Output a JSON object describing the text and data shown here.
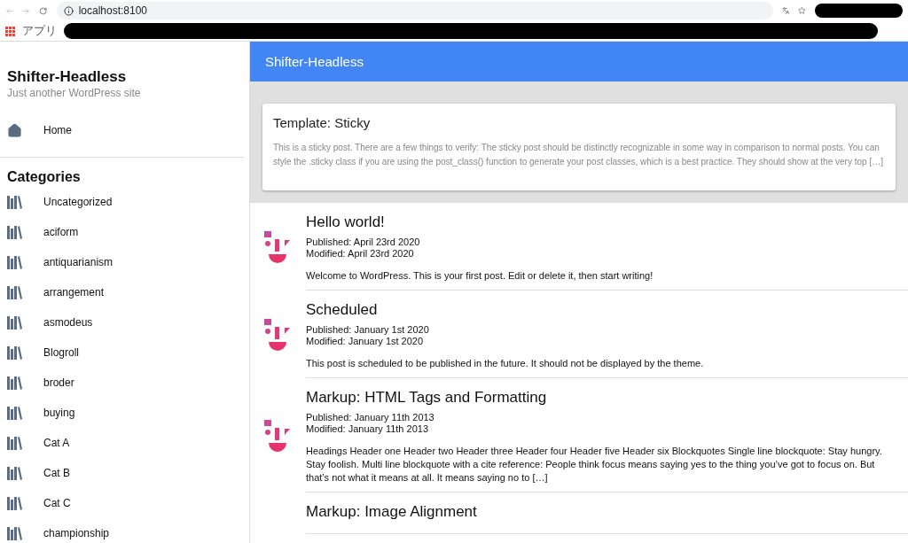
{
  "browser": {
    "url": "localhost:8100",
    "bookmarks_label": "アプリ"
  },
  "sidebar": {
    "site_title": "Shifter-Headless",
    "tagline": "Just another WordPress site",
    "nav": [
      {
        "label": "Home"
      }
    ],
    "categories_heading": "Categories",
    "categories": [
      {
        "label": "Uncategorized"
      },
      {
        "label": "aciform"
      },
      {
        "label": "antiquarianism"
      },
      {
        "label": "arrangement"
      },
      {
        "label": "asmodeus"
      },
      {
        "label": "Blogroll"
      },
      {
        "label": "broder"
      },
      {
        "label": "buying"
      },
      {
        "label": "Cat A"
      },
      {
        "label": "Cat B"
      },
      {
        "label": "Cat C"
      },
      {
        "label": "championship"
      }
    ]
  },
  "header": {
    "title": "Shifter-Headless"
  },
  "sticky": {
    "title": "Template: Sticky",
    "excerpt": "This is a sticky post. There are a few things to verify: The sticky post should be distinctly recognizable in some way in comparison to normal posts. You can style the .sticky class if you are using the post_class() function to generate your post classes, which is a best practice. They should show at the very top […]"
  },
  "posts": [
    {
      "title": "Hello world!",
      "published": "Published: April 23rd 2020",
      "modified": "Modified: April 23rd 2020",
      "excerpt": "Welcome to WordPress. This is your first post. Edit or delete it, then start writing!"
    },
    {
      "title": "Scheduled",
      "published": "Published: January 1st 2020",
      "modified": "Modified: January 1st 2020",
      "excerpt": "This post is scheduled to be published in the future. It should not be displayed by the theme."
    },
    {
      "title": "Markup: HTML Tags and Formatting",
      "published": "Published: January 11th 2013",
      "modified": "Modified: January 11th 2013",
      "excerpt": "Headings Header one Header two Header three Header four Header five Header six Blockquotes Single line blockquote: Stay hungry. Stay foolish. Multi line blockquote with a cite reference: People think focus means saying yes to the thing you’ve got to focus on. But that’s not what it means at all. It means saying no to […]"
    },
    {
      "title": "Markup: Image Alignment"
    }
  ]
}
